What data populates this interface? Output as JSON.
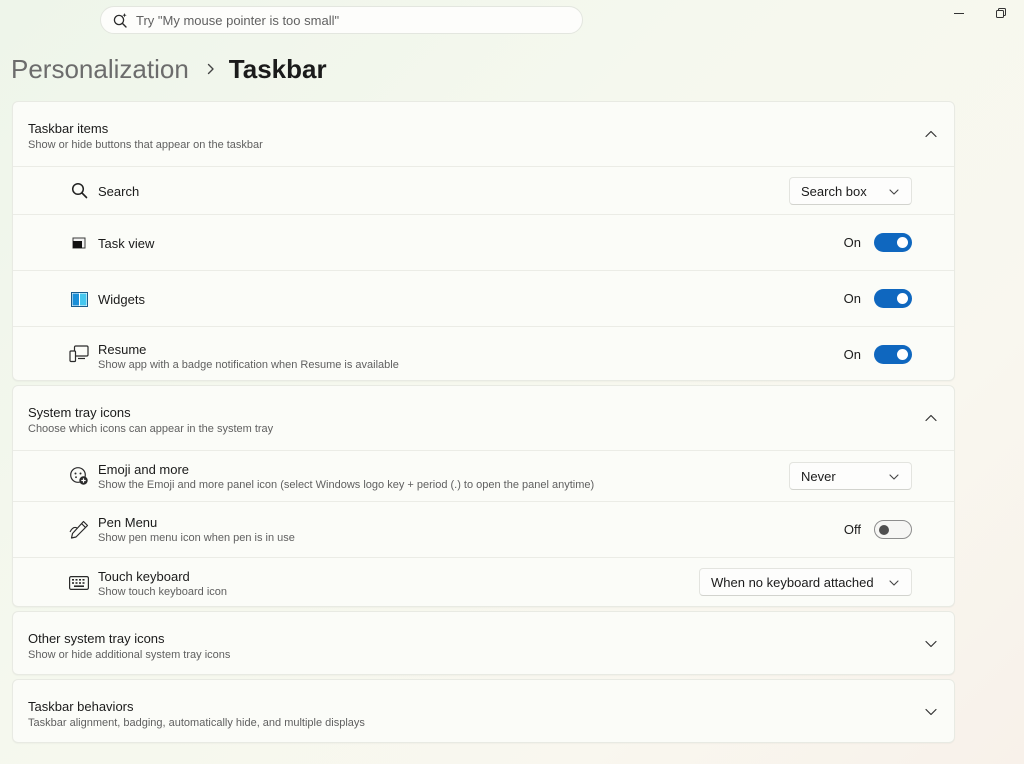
{
  "search": {
    "placeholder": "Try \"My mouse pointer is too small\""
  },
  "window_controls": [
    "minimize-icon",
    "restore-icon"
  ],
  "breadcrumb": {
    "parent": "Personalization",
    "current": "Taskbar"
  },
  "colors": {
    "accent": "#0f67bf"
  },
  "taskbar_items": {
    "title": "Taskbar items",
    "description": "Show or hide buttons that appear on the taskbar",
    "expanded": true,
    "rows": {
      "search": {
        "title": "Search",
        "icon": "search-icon",
        "dropdown_value": "Search box"
      },
      "task_view": {
        "title": "Task view",
        "icon": "task-view-icon",
        "toggle_label": "On",
        "toggle_on": true
      },
      "widgets": {
        "title": "Widgets",
        "icon": "widgets-icon",
        "toggle_label": "On",
        "toggle_on": true
      },
      "resume": {
        "title": "Resume",
        "description": "Show app with a badge notification when Resume is available",
        "icon": "resume-icon",
        "toggle_label": "On",
        "toggle_on": true
      }
    }
  },
  "system_tray_icons": {
    "title": "System tray icons",
    "description": "Choose which icons can appear in the system tray",
    "expanded": true,
    "rows": {
      "emoji": {
        "title": "Emoji and more",
        "description": "Show the Emoji and more panel icon (select Windows logo key + period (.) to open the panel anytime)",
        "icon": "emoji-icon",
        "dropdown_value": "Never"
      },
      "pen_menu": {
        "title": "Pen Menu",
        "description": "Show pen menu icon when pen is in use",
        "icon": "pen-icon",
        "toggle_label": "Off",
        "toggle_on": false
      },
      "touch_keyboard": {
        "title": "Touch keyboard",
        "description": "Show touch keyboard icon",
        "icon": "keyboard-icon",
        "dropdown_value": "When no keyboard attached"
      }
    }
  },
  "other_system_tray_icons": {
    "title": "Other system tray icons",
    "description": "Show or hide additional system tray icons",
    "expanded": false
  },
  "taskbar_behaviors": {
    "title": "Taskbar behaviors",
    "description": "Taskbar alignment, badging, automatically hide, and multiple displays",
    "expanded": false
  }
}
